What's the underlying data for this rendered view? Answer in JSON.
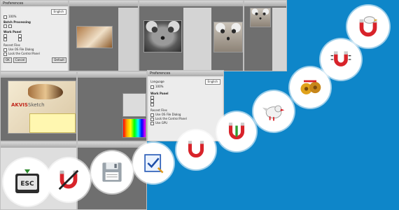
{
  "windows": {
    "prefs_a": {
      "title": "Preferences",
      "language": "English",
      "file_scale": "100%",
      "group_title": "Batch Processing",
      "panel_title": "Work Panel",
      "recent_files": "Recent Files",
      "use_os_dialog": "Use OS File Dialog",
      "lock_panel": "Lock the Control Panel",
      "ok": "OK",
      "cancel": "Cancel",
      "default": "Default"
    },
    "prefs_b": {
      "title": "Preferences",
      "language": "Language",
      "language_value": "English",
      "file_scale": "100%",
      "panel_title": "Work Panel",
      "recent_files": "Recent Files",
      "use_os_dialog": "Use OS File Dialog",
      "lock_panel": "Lock the Control Panel",
      "use_gpu": "Use GPU"
    },
    "akvis_banner": {
      "brand": "AKVIS",
      "product": "Sketch"
    }
  },
  "icons": [
    {
      "name": "esc-key-icon"
    },
    {
      "name": "crossed-magnet-icon"
    },
    {
      "name": "floppy-disk-icon"
    },
    {
      "name": "check-document-icon"
    },
    {
      "name": "magnet-icon"
    },
    {
      "name": "magnet-pencil-icon"
    },
    {
      "name": "bird-icon"
    },
    {
      "name": "gold-magnet-icon"
    },
    {
      "name": "magnet-lines-icon"
    },
    {
      "name": "bird-magnet-icon"
    }
  ],
  "colors": {
    "background": "#0e86c9",
    "magnet_red": "#d8232a",
    "magnet_gold": "#e0a21b"
  }
}
